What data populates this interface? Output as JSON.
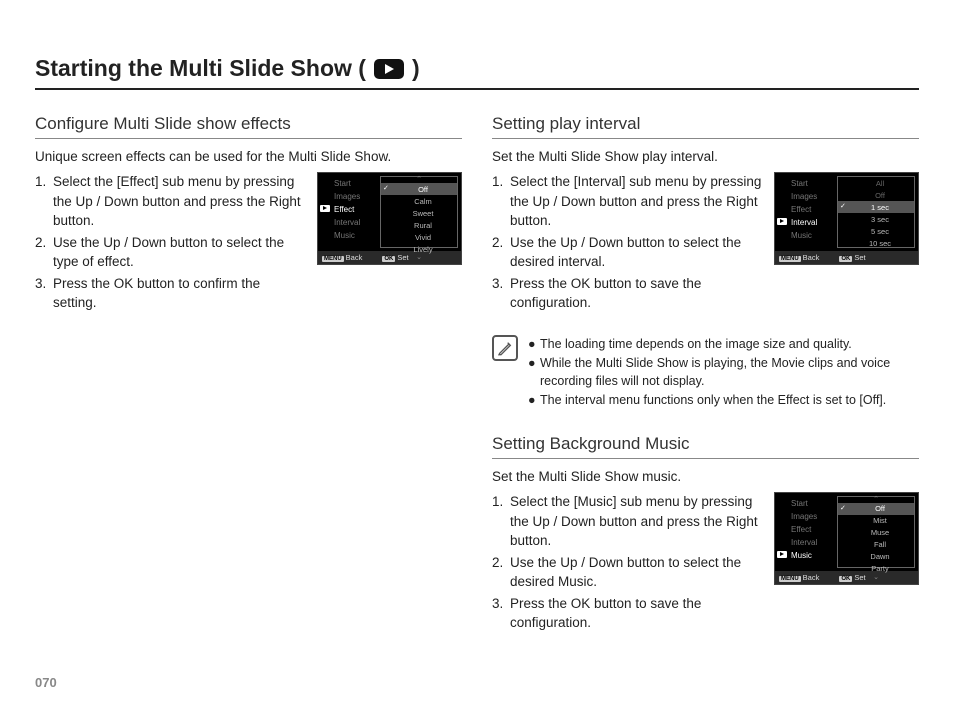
{
  "title_prefix": "Starting the Multi Slide Show (",
  "title_suffix": ")",
  "page_number": "070",
  "left": {
    "heading": "Configure Multi Slide show effects",
    "lead": "Unique screen effects can be used for the Multi Slide Show.",
    "steps": [
      "Select the [Effect] sub menu by pressing the Up / Down button and press the Right button.",
      "Use the Up / Down button to select the type of effect.",
      "Press the OK button to confirm the setting."
    ],
    "lcd": {
      "menu": [
        "Start",
        "Images",
        "Effect",
        "Interval",
        "Music"
      ],
      "active_index": 2,
      "options": [
        "Off",
        "Calm",
        "Sweet",
        "Rural",
        "Vivid",
        "Lively"
      ],
      "selected_index": 0,
      "footer_back": "Back",
      "footer_set": "Set",
      "btn_menu": "MENU",
      "btn_ok": "OK"
    }
  },
  "right_interval": {
    "heading": "Setting play interval",
    "lead": "Set the Multi Slide Show play interval.",
    "steps": [
      "Select the [Interval] sub menu by pressing the Up / Down button and press the Right button.",
      "Use the Up / Down button to select the desired interval.",
      "Press the OK button to save the configuration."
    ],
    "lcd": {
      "menu": [
        "Start",
        "Images",
        "Effect",
        "Interval",
        "Music"
      ],
      "active_index": 3,
      "dim_options": [
        "All",
        "Off"
      ],
      "options": [
        "1 sec",
        "3 sec",
        "5 sec",
        "10 sec"
      ],
      "selected_index": 0,
      "footer_back": "Back",
      "footer_set": "Set",
      "btn_menu": "MENU",
      "btn_ok": "OK"
    }
  },
  "notes": [
    "The loading time depends on the image size and quality.",
    "While the Multi Slide Show is playing, the Movie clips and voice recording files will not display.",
    "The interval menu functions only when the Effect is set to [Off]."
  ],
  "right_music": {
    "heading": "Setting Background Music",
    "lead": "Set the Multi Slide Show music.",
    "steps": [
      "Select the [Music] sub menu by pressing the Up / Down button and press the Right button.",
      "Use the Up / Down button to select the desired Music.",
      "Press the OK button to save the configuration."
    ],
    "lcd": {
      "menu": [
        "Start",
        "Images",
        "Effect",
        "Interval",
        "Music"
      ],
      "active_index": 4,
      "options": [
        "Off",
        "Mist",
        "Muse",
        "Fall",
        "Dawn",
        "Party"
      ],
      "selected_index": 0,
      "footer_back": "Back",
      "footer_set": "Set",
      "btn_menu": "MENU",
      "btn_ok": "OK"
    }
  }
}
